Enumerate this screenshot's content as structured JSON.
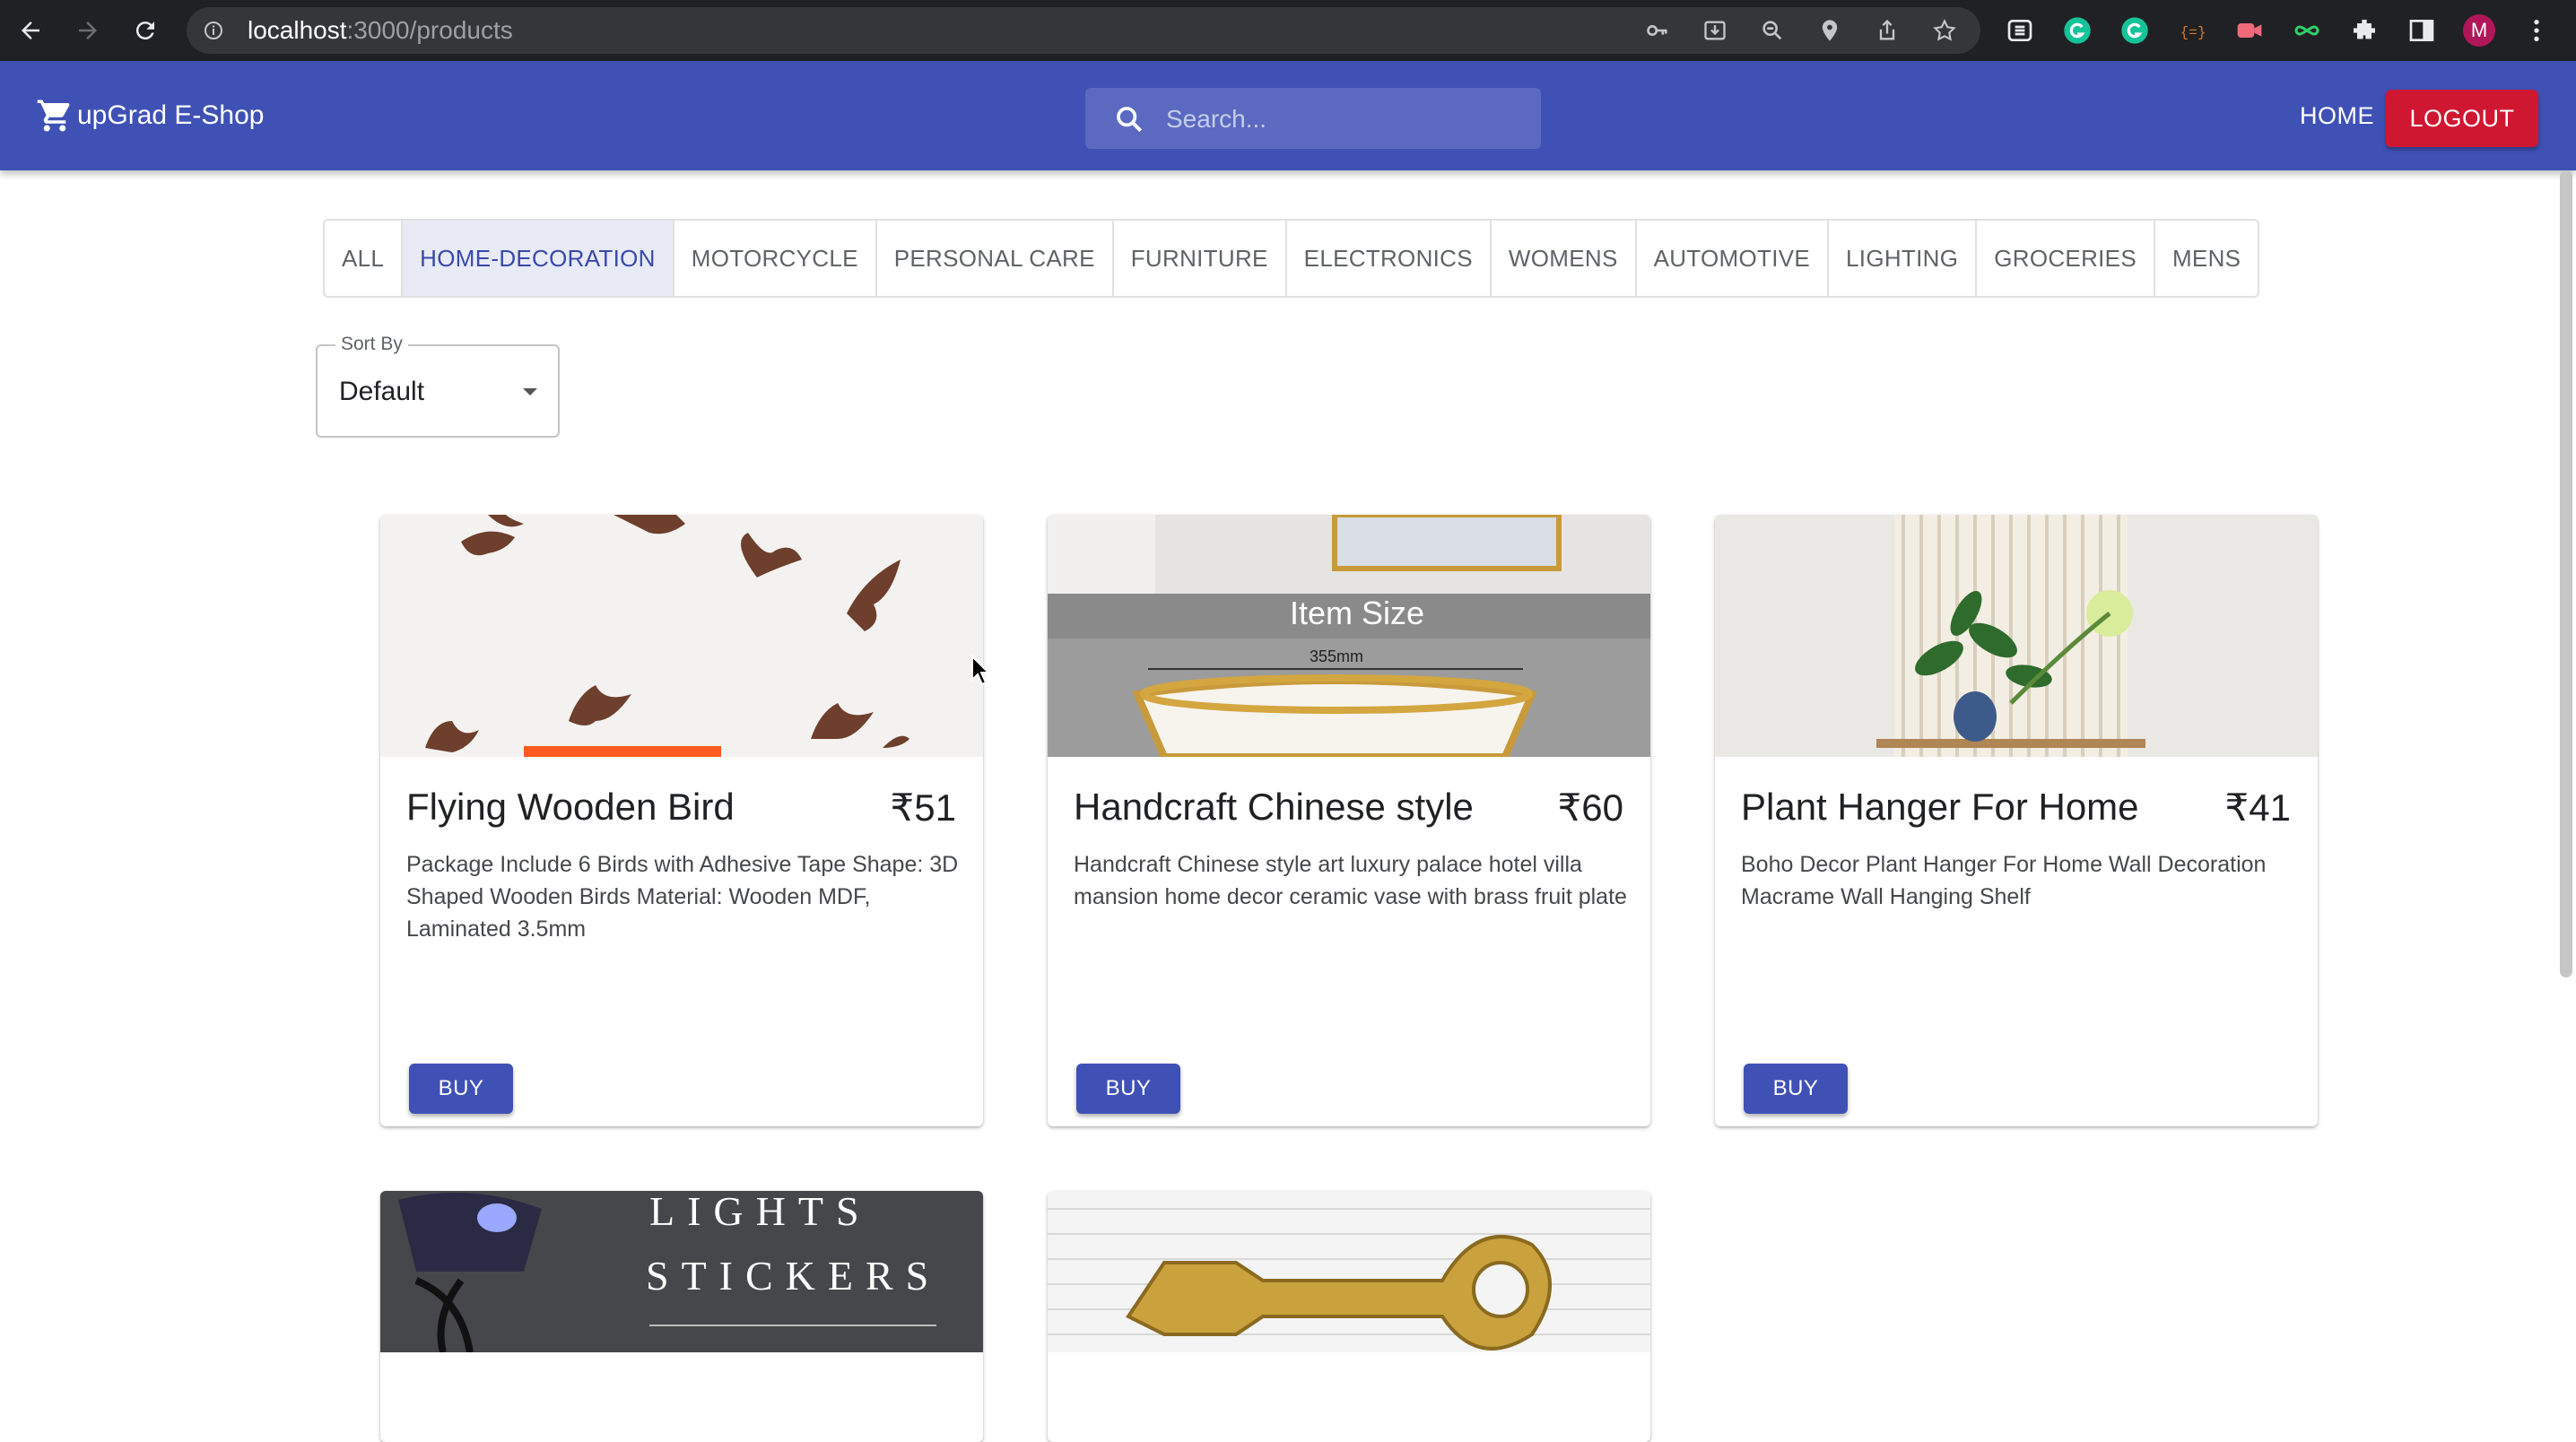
{
  "browser": {
    "url_host": "localhost",
    "url_path": ":3000/products",
    "avatar_letter": "M"
  },
  "header": {
    "brand": "upGrad E-Shop",
    "search_placeholder": "Search...",
    "home_label": "HOME",
    "logout_label": "LOGOUT",
    "color": "#3f51b5"
  },
  "categories": {
    "selected": "HOME-DECORATION",
    "items": [
      "ALL",
      "HOME-DECORATION",
      "MOTORCYCLE",
      "PERSONAL CARE",
      "FURNITURE",
      "ELECTRONICS",
      "WOMENS",
      "AUTOMOTIVE",
      "LIGHTING",
      "GROCERIES",
      "MENS"
    ]
  },
  "sort": {
    "label": "Sort By",
    "value": "Default"
  },
  "products": [
    {
      "name": "Flying Wooden Bird",
      "price": "₹51",
      "description": "Package Include 6 Birds with Adhesive Tape Shape: 3D Shaped Wooden Birds Material: Wooden MDF, Laminated 3.5mm",
      "buy_label": "BUY"
    },
    {
      "name": "Handcraft Chinese style",
      "price": "₹60",
      "description": "Handcraft Chinese style art luxury palace hotel villa mansion home decor ceramic vase with brass fruit plate",
      "buy_label": "BUY",
      "image_text": "Item Size",
      "image_dimension": "355mm"
    },
    {
      "name": "Plant Hanger For Home",
      "price": "₹41",
      "description": "Boho Decor Plant Hanger For Home Wall Decoration Macrame Wall Hanging Shelf",
      "buy_label": "BUY"
    }
  ],
  "partial_products": [
    {
      "image_text_1": "LIGHTS",
      "image_text_2": "STICKERS"
    },
    {
      "image_text_1": ""
    }
  ],
  "colors": {
    "primary": "#3f51b5",
    "logout": "#d01731",
    "selected_tab_bg": "#e8eaf6"
  }
}
